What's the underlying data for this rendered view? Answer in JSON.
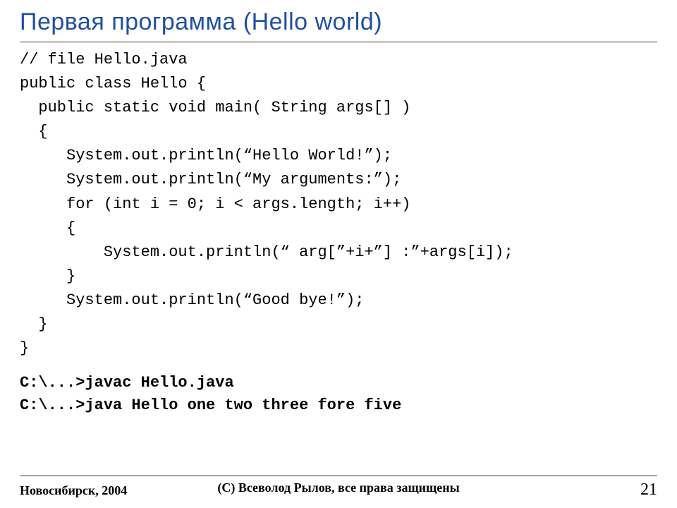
{
  "title": "Первая программа (Hello world)",
  "code": {
    "l1": "// file Hello.java",
    "l2": "public class Hello {",
    "l3": "  public static void main( String args[] )",
    "l4": "  {",
    "l5": "     System.out.println(“Hello World!”);",
    "l6": "     System.out.println(“My arguments:”);",
    "l7": "     for (int i = 0; i < args.length; i++)",
    "l8": "     {",
    "l9": "         System.out.println(“ arg[”+i+”] :”+args[i]);",
    "l10": "     }",
    "l11": "     System.out.println(“Good bye!”);",
    "l12": "  }",
    "l13": "}"
  },
  "commands": {
    "c1": "C:\\...>javac Hello.java",
    "c2": "C:\\...>java Hello one two three fore five"
  },
  "footer": {
    "left": "Новосибирск, 2004",
    "center": "(С) Всеволод Рылов, все права защищены",
    "right": "21"
  }
}
